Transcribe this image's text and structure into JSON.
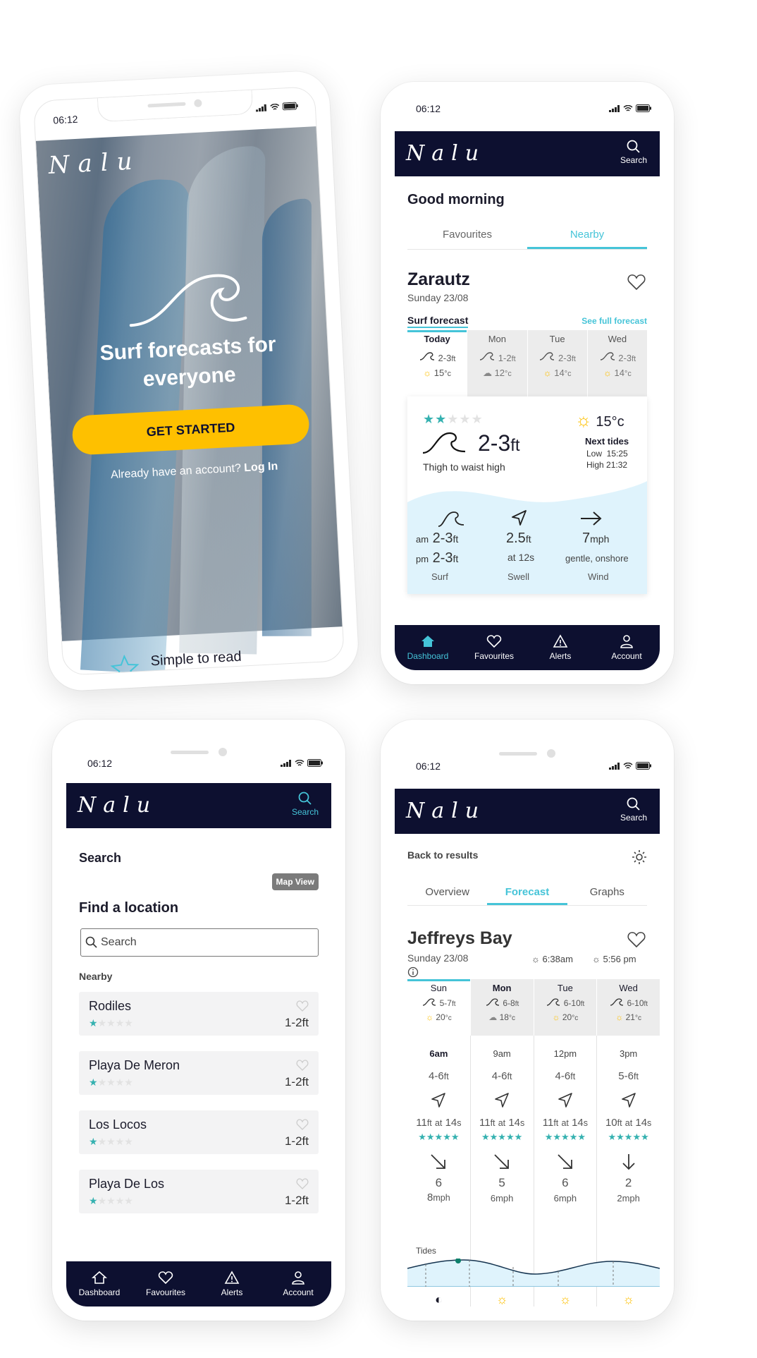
{
  "status": {
    "time": "06:12"
  },
  "brand": {
    "logo": "Nalu"
  },
  "nav": {
    "search_label": "Search"
  },
  "tabs": {
    "dashboard": "Dashboard",
    "favourites": "Favourites",
    "alerts": "Alerts",
    "account": "Account"
  },
  "welcome": {
    "headline": "Surf forecasts for everyone",
    "cta": "GET STARTED",
    "account_text": "Already have an account?",
    "login_link": "Log In",
    "feature_teaser": "Simple to read"
  },
  "dashboard": {
    "greeting": "Good morning",
    "tabs": [
      "Favourites",
      "Nearby"
    ],
    "active_tab": "Nearby",
    "spot": {
      "name": "Zarautz",
      "date": "Sunday 23/08"
    },
    "surf_forecast_label": "Surf forecast",
    "see_full": "See full forecast",
    "days": [
      {
        "day": "Today",
        "wave": "2-3",
        "wave_unit": "ft",
        "temp": "15",
        "temp_unit": "°c",
        "weather": "sun-icon"
      },
      {
        "day": "Mon",
        "wave": "1-2",
        "wave_unit": "ft",
        "temp": "12",
        "temp_unit": "°c",
        "weather": "cloud-icon"
      },
      {
        "day": "Tue",
        "wave": "2-3",
        "wave_unit": "ft",
        "temp": "14",
        "temp_unit": "°c",
        "weather": "sun-icon"
      },
      {
        "day": "Wed",
        "wave": "2-3",
        "wave_unit": "ft",
        "temp": "14",
        "temp_unit": "°c",
        "weather": "sun-icon"
      }
    ],
    "detail": {
      "rating": 2,
      "rating_max": 5,
      "wave_height": "2-3",
      "wave_unit": "ft",
      "wave_desc": "Thigh to waist high",
      "temp": "15°c",
      "next_tides_label": "Next tides",
      "low_tide": "Low  15:25",
      "high_tide": "High 21:32"
    },
    "conditions": {
      "am_label": "am",
      "pm_label": "pm",
      "surf_am": "2-3",
      "surf_pm": "2-3",
      "surf_unit": "ft",
      "swell": "2.5",
      "swell_unit": "ft",
      "swell_period_prefix": "at",
      "swell_period": "12",
      "swell_period_unit": "s",
      "wind": "7",
      "wind_unit": "mph",
      "wind_desc": "gentle, onshore",
      "surf_label": "Surf",
      "swell_label": "Swell",
      "wind_label": "Wind"
    }
  },
  "search": {
    "title": "Search",
    "map_view": "Map View",
    "find_heading": "Find a location",
    "placeholder": "Search",
    "nearby_label": "Nearby",
    "results": [
      {
        "name": "Rodiles",
        "rating": 1,
        "height": "1-2ft"
      },
      {
        "name": "Playa De Meron",
        "rating": 1,
        "height": "1-2ft"
      },
      {
        "name": "Los Locos",
        "rating": 1,
        "height": "1-2ft"
      },
      {
        "name": "Playa De Los",
        "rating": 1,
        "height": "1-2ft"
      }
    ]
  },
  "forecast": {
    "back": "Back to results",
    "tabs": [
      "Overview",
      "Forecast",
      "Graphs"
    ],
    "active_tab": "Forecast",
    "spot": {
      "name": "Jeffreys Bay",
      "date": "Sunday 23/08"
    },
    "sunrise": "6:38am",
    "sunset": "5:56 pm",
    "days": [
      {
        "day": "Sun",
        "wave": "5-7",
        "temp": "20"
      },
      {
        "day": "Mon",
        "wave": "6-8",
        "temp": "18"
      },
      {
        "day": "Tue",
        "wave": "6-10",
        "temp": "20"
      },
      {
        "day": "Wed",
        "wave": "6-10",
        "temp": "21"
      }
    ],
    "hours": [
      {
        "time": "6am",
        "wave": "4-6",
        "swell": "11",
        "period": "14",
        "wind": "6",
        "wind2": "8",
        "wind_unit": "mph"
      },
      {
        "time": "9am",
        "wave": "4-6",
        "swell": "11",
        "period": "14",
        "wind": "5",
        "wind2": "6mph",
        "wind_unit": ""
      },
      {
        "time": "12pm",
        "wave": "4-6",
        "swell": "11",
        "period": "14",
        "wind": "6",
        "wind2": "6mph",
        "wind_unit": ""
      },
      {
        "time": "3pm",
        "wave": "5-6",
        "swell": "10",
        "period": "14",
        "wind": "2",
        "wind2": "2mph",
        "wind_unit": ""
      }
    ],
    "tides_label": "Tides",
    "ft_unit": "ft",
    "at_text": "at",
    "s_unit": "s",
    "deg_c": "°c"
  },
  "colors": {
    "navy": "#0d1030",
    "teal": "#45c4d8",
    "star": "#35b1b0",
    "yellow": "#fec000",
    "light_blue": "#dff3fc"
  }
}
